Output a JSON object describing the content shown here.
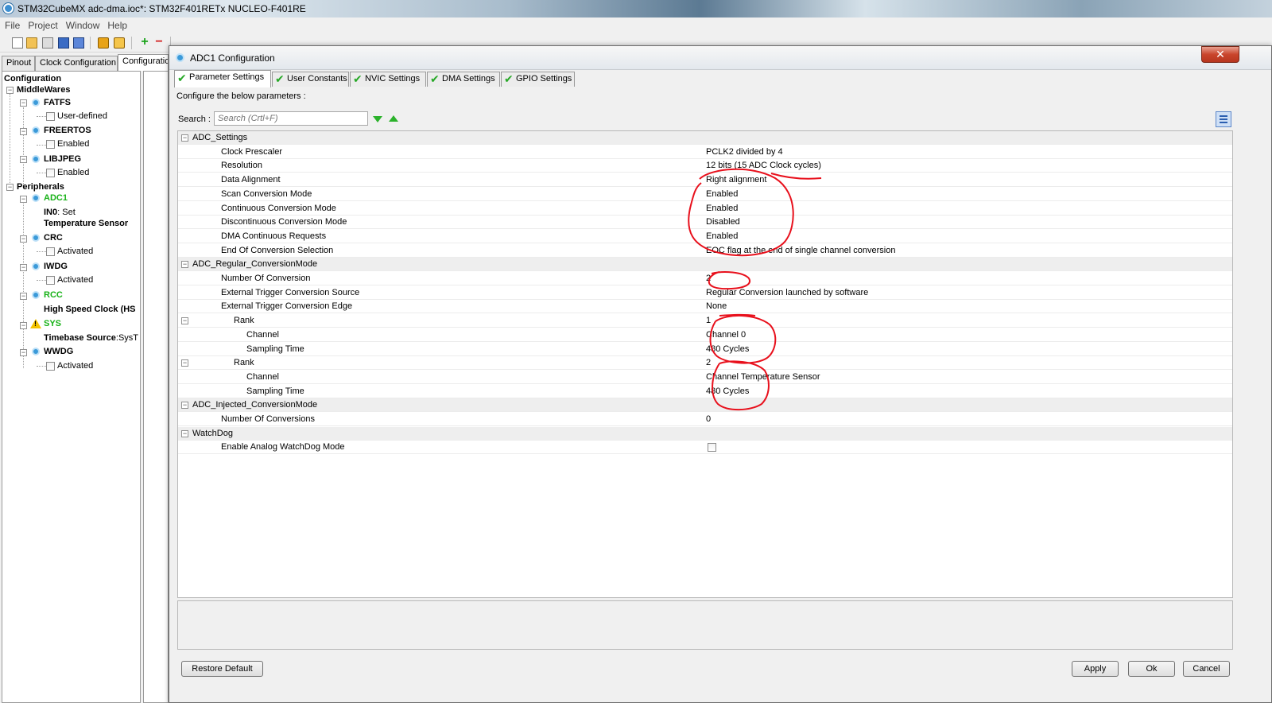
{
  "window": {
    "title": "STM32CubeMX adc-dma.ioc*: STM32F401RETx NUCLEO-F401RE"
  },
  "menu": [
    "File",
    "Project",
    "Window",
    "Help"
  ],
  "main_tabs": [
    "Pinout",
    "Clock Configuration",
    "Configuration"
  ],
  "tree": {
    "root": "Configuration",
    "middlewares_label": "MiddleWares",
    "fatfs": "FATFS",
    "fatfs_option": "User-defined",
    "freertos": "FREERTOS",
    "freertos_option": "Enabled",
    "libjpeg": "LIBJPEG",
    "libjpeg_option": "Enabled",
    "peripherals_label": "Peripherals",
    "adc1": "ADC1",
    "adc1_in0_key": "IN0",
    "adc1_in0_val": ": Set",
    "adc1_temp": "Temperature Sensor",
    "crc": "CRC",
    "crc_option": "Activated",
    "iwdg": "IWDG",
    "iwdg_option": "Activated",
    "rcc": "RCC",
    "rcc_hse": "High Speed Clock (HS",
    "sys": "SYS",
    "sys_timebase_key": "Timebase Source",
    "sys_timebase_val": ":SysT",
    "wwdg": "WWDG",
    "wwdg_option": "Activated"
  },
  "dialog": {
    "title": "ADC1 Configuration",
    "close_glyph": "✕",
    "tabs": [
      "Parameter Settings",
      "User Constants",
      "NVIC Settings",
      "DMA Settings",
      "GPIO Settings"
    ],
    "configure_label": "Configure the below parameters :",
    "search_label": "Search :",
    "search_placeholder": "Search (Crtl+F)",
    "buttons": {
      "restore": "Restore Default",
      "apply": "Apply",
      "ok": "Ok",
      "cancel": "Cancel"
    },
    "rows": [
      {
        "type": "group",
        "name": "ADC_Settings",
        "value": ""
      },
      {
        "type": "param",
        "name": "Clock Prescaler",
        "value": "PCLK2 divided by 4"
      },
      {
        "type": "param",
        "name": "Resolution",
        "value": "12 bits (15 ADC Clock cycles)"
      },
      {
        "type": "param",
        "name": "Data Alignment",
        "value": "Right alignment"
      },
      {
        "type": "param",
        "name": "Scan Conversion Mode",
        "value": "Enabled"
      },
      {
        "type": "param",
        "name": "Continuous Conversion Mode",
        "value": "Enabled"
      },
      {
        "type": "param",
        "name": "Discontinuous Conversion Mode",
        "value": "Disabled"
      },
      {
        "type": "param",
        "name": "DMA Continuous Requests",
        "value": "Enabled"
      },
      {
        "type": "param",
        "name": "End Of Conversion Selection",
        "value": "EOC flag at the end of single channel conversion"
      },
      {
        "type": "group",
        "name": "ADC_Regular_ConversionMode",
        "value": ""
      },
      {
        "type": "param",
        "name": "Number Of Conversion",
        "value": "2"
      },
      {
        "type": "param",
        "name": "External Trigger Conversion Source",
        "value": "Regular Conversion launched by software"
      },
      {
        "type": "param",
        "name": "External Trigger Conversion Edge",
        "value": "None"
      },
      {
        "type": "rank",
        "name": "Rank",
        "value": "1"
      },
      {
        "type": "sub",
        "name": "Channel",
        "value": "Channel 0"
      },
      {
        "type": "sub",
        "name": "Sampling Time",
        "value": "480 Cycles"
      },
      {
        "type": "rank",
        "name": "Rank",
        "value": "2"
      },
      {
        "type": "sub",
        "name": "Channel",
        "value": "Channel Temperature Sensor"
      },
      {
        "type": "sub",
        "name": "Sampling Time",
        "value": "480 Cycles"
      },
      {
        "type": "group",
        "name": "ADC_Injected_ConversionMode",
        "value": ""
      },
      {
        "type": "param",
        "name": "Number Of Conversions",
        "value": "0"
      },
      {
        "type": "group",
        "name": "WatchDog",
        "value": ""
      },
      {
        "type": "checkbox",
        "name": "Enable Analog WatchDog Mode",
        "value": "",
        "checked": false
      }
    ]
  },
  "colors": {
    "annotation": "#e8101c",
    "enabled_tree": "#18b218",
    "check": "#26a826"
  }
}
